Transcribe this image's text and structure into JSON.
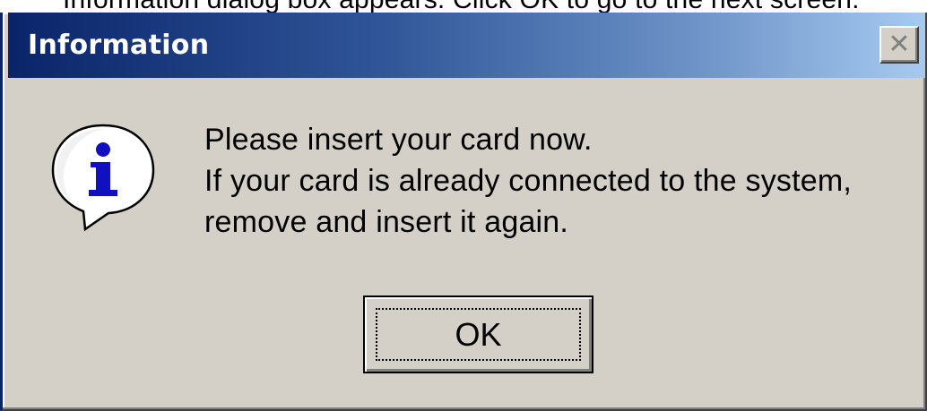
{
  "background": {
    "partial_text": "Information dialog box appears. Click OK to go to the next screen."
  },
  "dialog": {
    "title": "Information",
    "close_symbol": "✕",
    "icon": "information-icon",
    "message_lines": [
      "Please insert your card now.",
      "If your card is already connected to the system,",
      "remove and insert it again."
    ],
    "ok_label": "OK"
  },
  "colors": {
    "title_start": "#0a246a",
    "title_end": "#a6caf0",
    "dialog_face": "#d4d0c8",
    "icon_fill": "#1010c0"
  }
}
